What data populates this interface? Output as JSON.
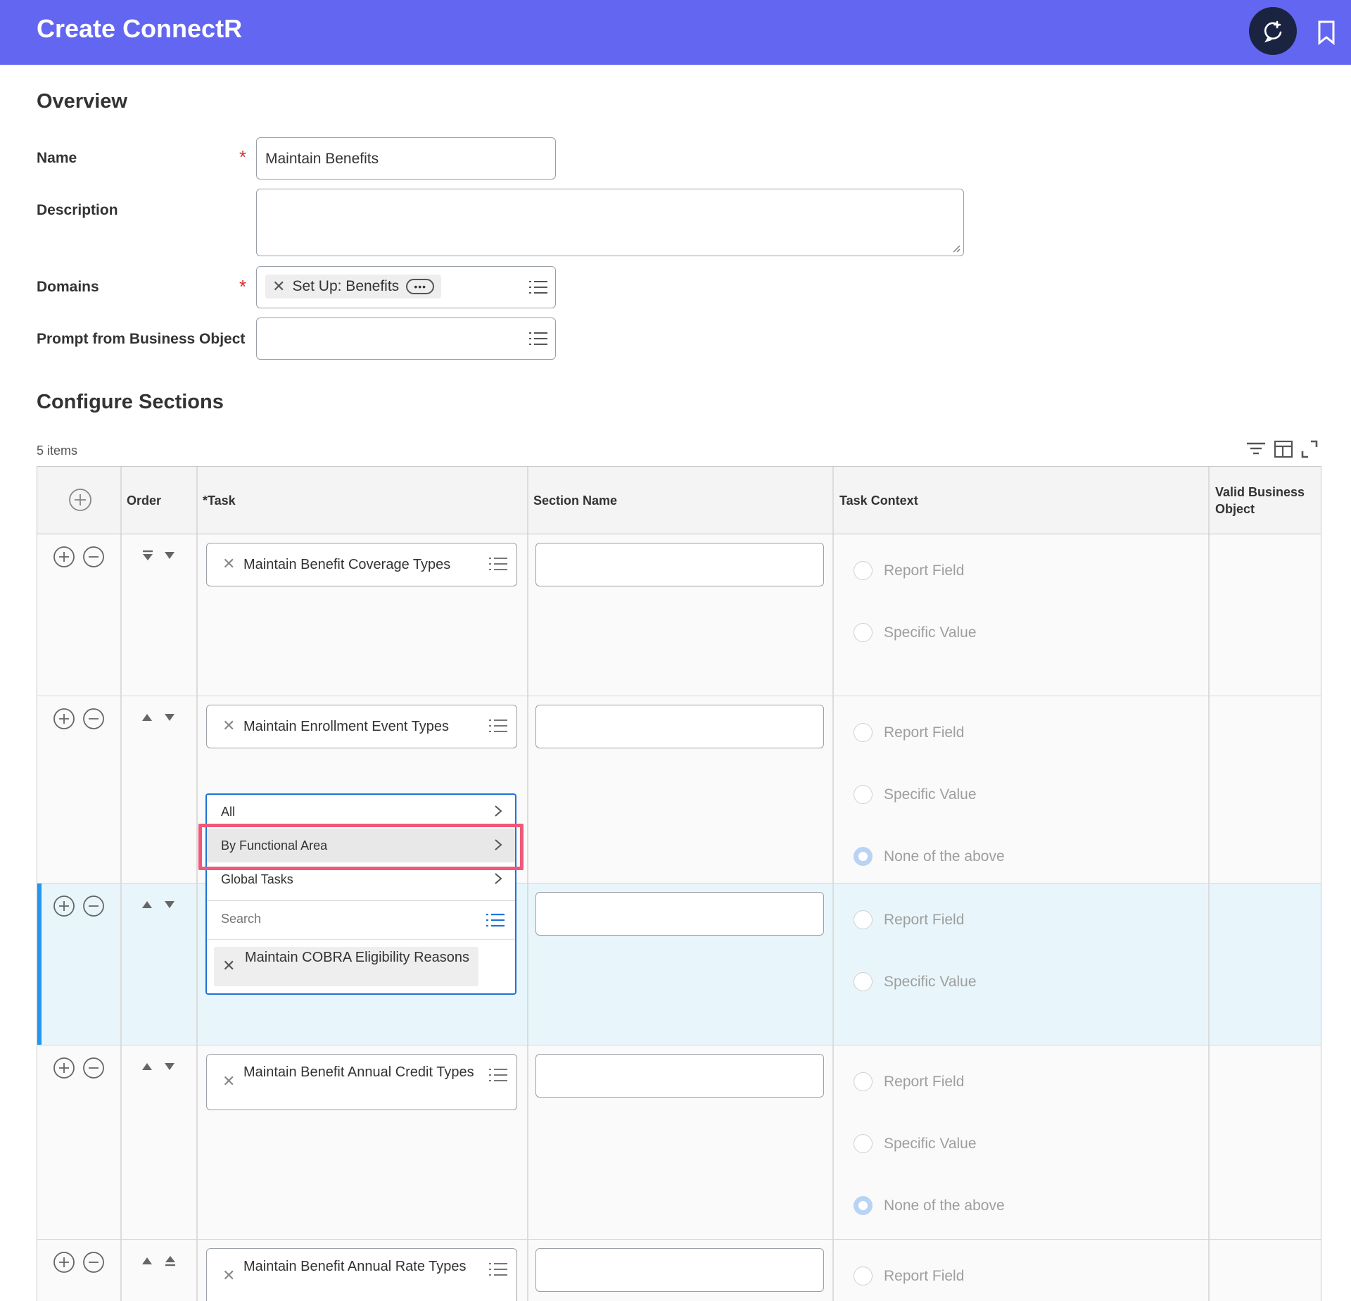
{
  "header": {
    "title": "Create ConnectR",
    "assist_icon": "ai-assist-icon",
    "bookmark_icon": "bookmark-icon",
    "color": "#6366f1"
  },
  "overview": {
    "heading": "Overview",
    "name_label": "Name",
    "name_value": "Maintain Benefits",
    "description_label": "Description",
    "description_value": "",
    "domains_label": "Domains",
    "domains_value": "Set Up: Benefits",
    "prompt_label": "Prompt from Business Object",
    "prompt_value": ""
  },
  "sections": {
    "heading": "Configure Sections",
    "count": "5 items",
    "columns": [
      "Order",
      "*Task",
      "Section Name",
      "Task Context",
      "Valid Business Object"
    ],
    "rows": [
      {
        "task": "Maintain Benefit Coverage Types",
        "section_name": "",
        "context_options": [
          "Report Field",
          "Specific Value"
        ]
      },
      {
        "task": "Maintain Enrollment Event Types",
        "section_name": "",
        "context_options": [
          "Report Field",
          "Specific Value",
          "None of the above"
        ],
        "selected": "None of the above"
      },
      {
        "task": "Maintain COBRA Eligibility Reasons",
        "section_name": "",
        "context_options": [
          "Report Field",
          "Specific Value"
        ]
      },
      {
        "task": "Maintain Benefit Annual Credit Types",
        "section_name": "",
        "context_options": [
          "Report Field",
          "Specific Value",
          "None of the above"
        ],
        "selected": "None of the above"
      },
      {
        "task": "Maintain Benefit Annual Rate Types",
        "section_name": "",
        "context_options": [
          "Report Field"
        ]
      }
    ]
  },
  "dropdown": {
    "options": [
      "All",
      "By Functional Area",
      "Global Tasks"
    ],
    "highlighted": "By Functional Area",
    "search_placeholder": "Search",
    "selected_chip": "Maintain COBRA Eligibility Reasons"
  }
}
